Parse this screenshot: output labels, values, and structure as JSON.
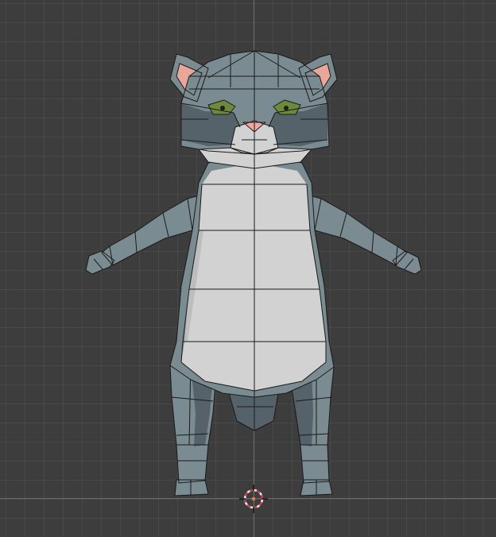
{
  "viewport": {
    "background": "#3d3d3d",
    "grid_line_color": "#474747",
    "x_axis_color": "#c8414b",
    "y_axis_color": "#4b77be"
  },
  "model": {
    "fur_gray": "#7b8b92",
    "fur_gray_dark": "#55626a",
    "belly_white": "#d2d2d2",
    "ear_inner": "#e9a79c",
    "nose": "#f0a7a0",
    "eye_green": "#6d8a3b",
    "wire": "#1a1a1a"
  },
  "origin_marker": {
    "ring_color": "#e8e8e8",
    "center_color": "#e07a4a",
    "icon": "3d-cursor-icon"
  }
}
